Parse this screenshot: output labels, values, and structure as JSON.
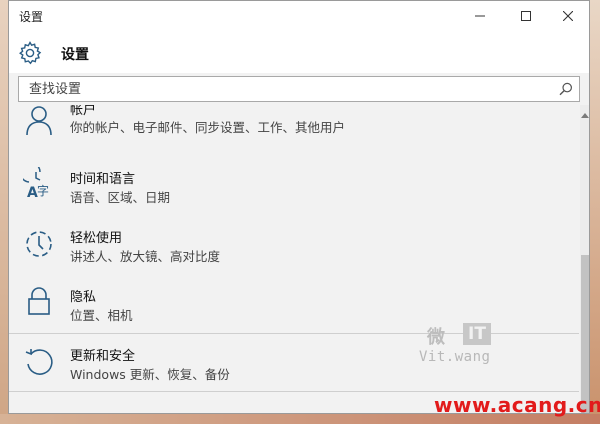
{
  "window": {
    "title": "设置"
  },
  "header": {
    "title": "设置"
  },
  "search": {
    "placeholder": "查找设置"
  },
  "items": [
    {
      "title": "帐户",
      "subtitle": "你的帐户、电子邮件、同步设置、工作、其他用户",
      "icon": "person-icon"
    },
    {
      "title": "时间和语言",
      "subtitle": "语音、区域、日期",
      "icon": "time-language-icon"
    },
    {
      "title": "轻松使用",
      "subtitle": "讲述人、放大镜、高对比度",
      "icon": "ease-of-access-icon"
    },
    {
      "title": "隐私",
      "subtitle": "位置、相机",
      "icon": "lock-icon"
    },
    {
      "title": "更新和安全",
      "subtitle": "Windows 更新、恢复、备份",
      "icon": "refresh-icon"
    }
  ],
  "watermark": {
    "char": "微",
    "box": "IT",
    "text": "Vit.wang"
  },
  "site_watermark": "www.acang.cn",
  "colors": {
    "accent": "#2a5d85",
    "window_bg": "#f2f2f2",
    "site_watermark": "#e21b1b"
  }
}
